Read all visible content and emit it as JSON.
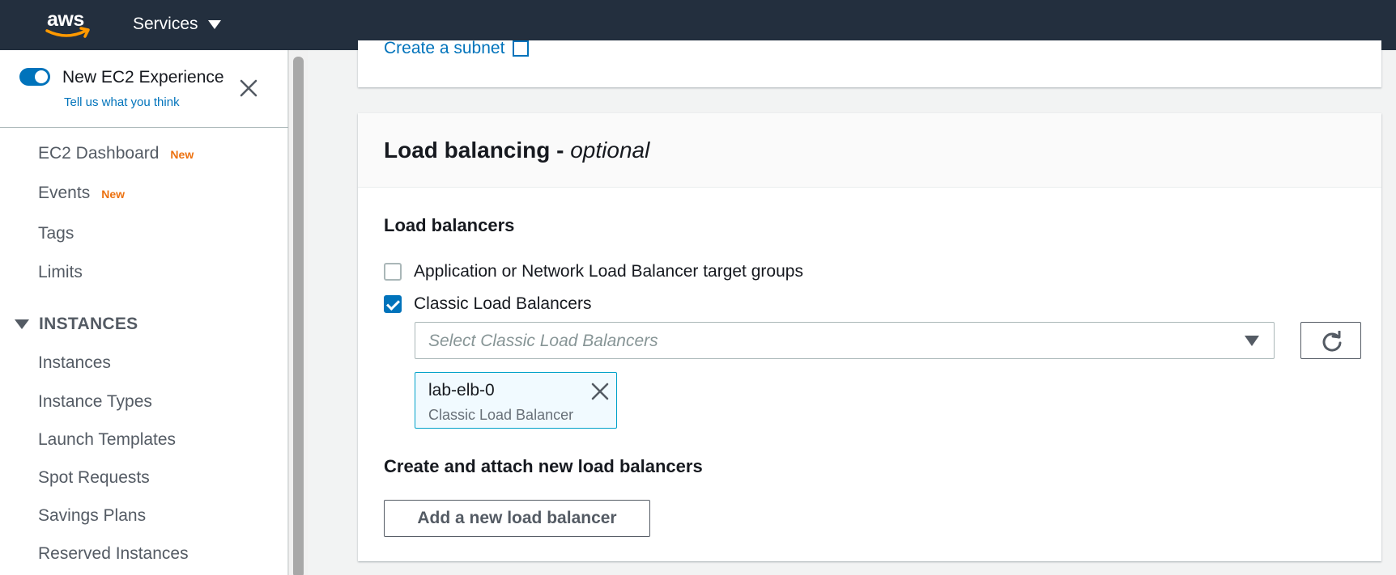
{
  "topnav": {
    "logo_text": "aws",
    "services_label": "Services"
  },
  "sidebar": {
    "experience": {
      "title": "New EC2 Experience",
      "feedback_link": "Tell us what you think",
      "toggle_on": true
    },
    "items": [
      {
        "label": "EC2 Dashboard",
        "badge": "New"
      },
      {
        "label": "Events",
        "badge": "New"
      },
      {
        "label": "Tags"
      },
      {
        "label": "Limits"
      }
    ],
    "section": {
      "label": "INSTANCES",
      "items": [
        {
          "label": "Instances"
        },
        {
          "label": "Instance Types"
        },
        {
          "label": "Launch Templates"
        },
        {
          "label": "Spot Requests"
        },
        {
          "label": "Savings Plans"
        },
        {
          "label": "Reserved Instances"
        }
      ]
    }
  },
  "main": {
    "create_subnet_link": "Create a subnet",
    "load_balancing": {
      "title": "Load balancing - ",
      "title_suffix": "optional",
      "lb_label": "Load balancers",
      "checkbox_target_groups": {
        "label": "Application or Network Load Balancer target groups",
        "checked": false
      },
      "checkbox_classic": {
        "label": "Classic Load Balancers",
        "checked": true
      },
      "select_placeholder": "Select Classic Load Balancers",
      "selected_token": {
        "name": "lab-elb-0",
        "description": "Classic Load Balancer"
      },
      "create_label": "Create and attach new load balancers",
      "add_button": "Add a new load balancer"
    }
  },
  "colors": {
    "nav_bg": "#232f3e",
    "accent": "#0073bb",
    "badge": "#ec7211",
    "aws_smile": "#ff9900"
  }
}
